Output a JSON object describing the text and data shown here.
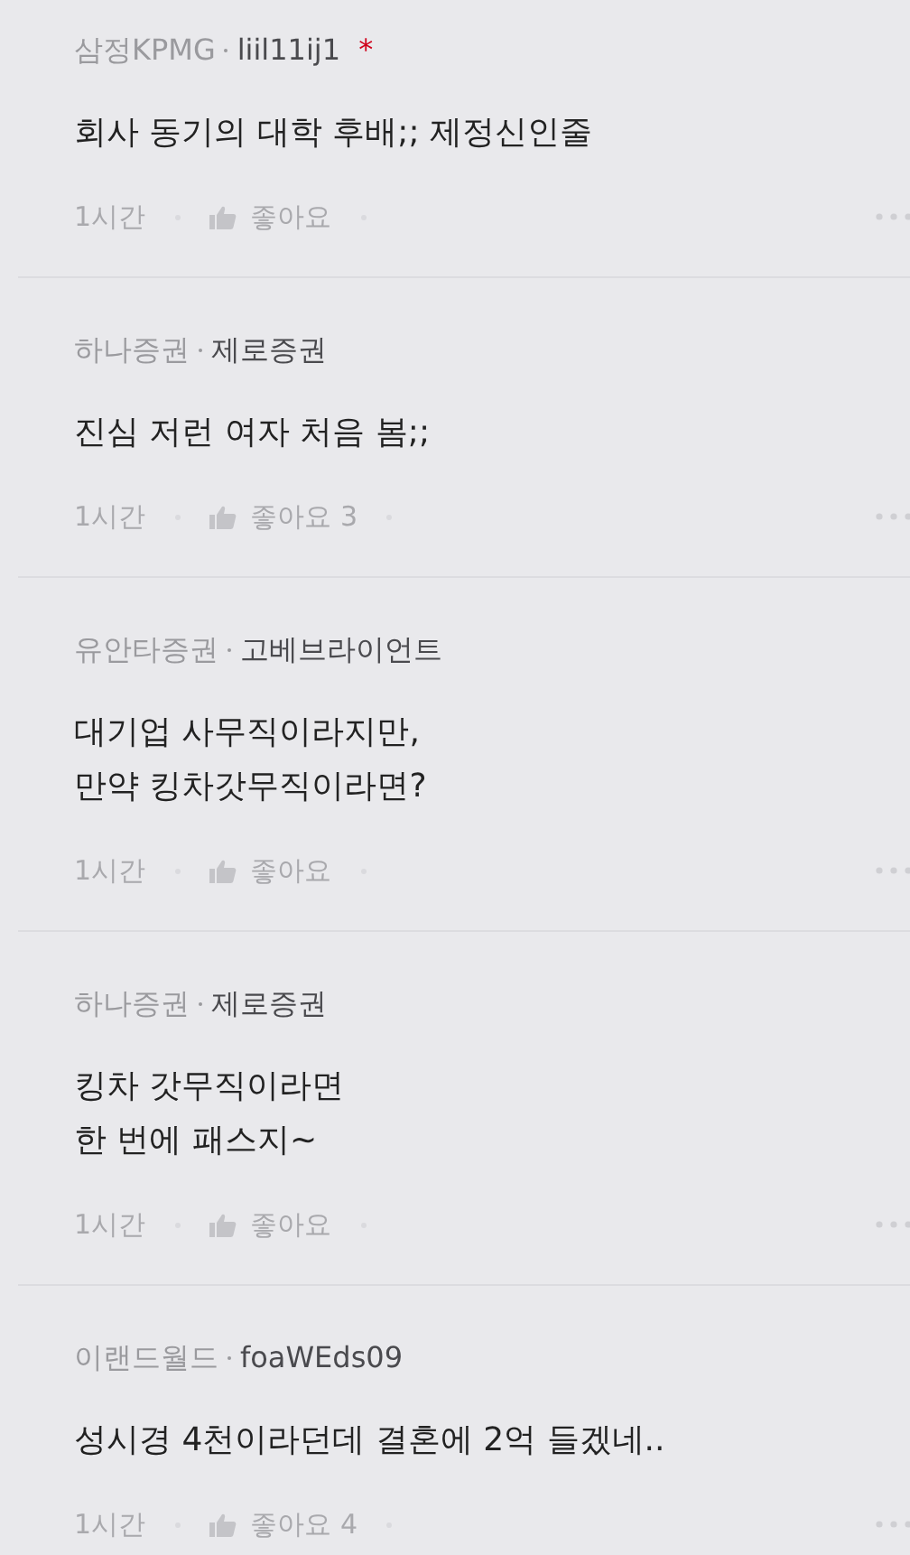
{
  "comments": [
    {
      "company": "삼정KPMG",
      "nickname": "liil11ij1",
      "badge": "*",
      "text": "회사 동기의 대학 후배;; 제정신인줄",
      "time": "1시간",
      "like_label": "좋아요"
    },
    {
      "company": "하나증권",
      "nickname": "제로증권",
      "text": "진심 저런 여자 처음 봄;;",
      "time": "1시간",
      "like_label": "좋아요",
      "like_count": "3"
    },
    {
      "company": "유안타증권",
      "nickname": "고베브라이언트",
      "text": "대기업 사무직이라지만,\n만약 킹차갓무직이라면?",
      "time": "1시간",
      "like_label": "좋아요"
    },
    {
      "company": "하나증권",
      "nickname": "제로증권",
      "text": "킹차 갓무직이라면\n한 번에 패스지~",
      "time": "1시간",
      "like_label": "좋아요"
    },
    {
      "company": "이랜드월드",
      "nickname": "foaWEds09",
      "text": "성시경 4천이라던데 결혼에 2억 들겠네..",
      "time": "1시간",
      "like_label": "좋아요",
      "like_count": "4"
    }
  ]
}
